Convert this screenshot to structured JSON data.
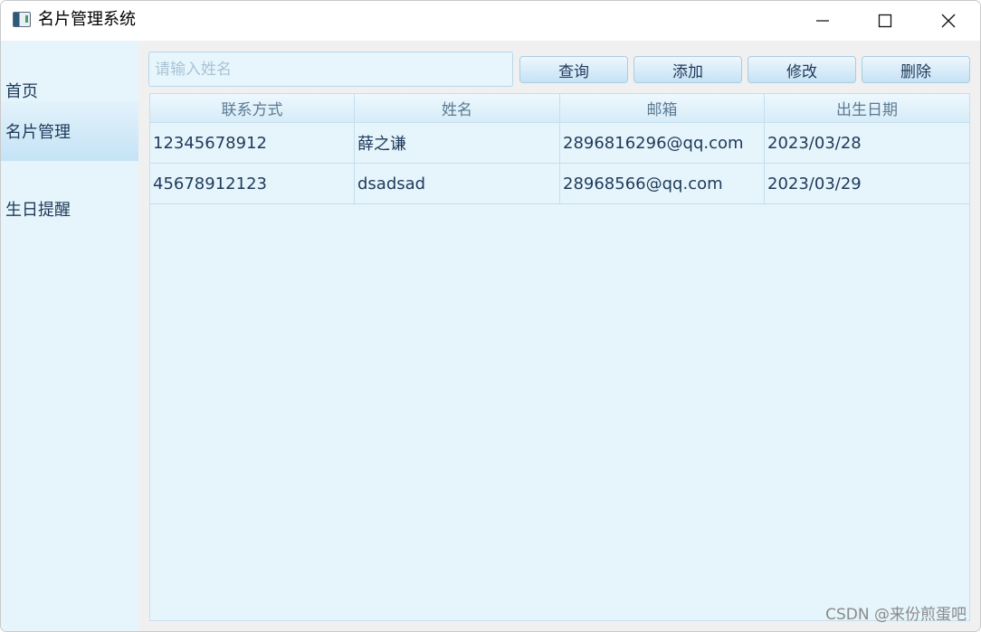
{
  "window": {
    "title": "名片管理系统"
  },
  "sidebar": {
    "items": [
      {
        "label": "首页",
        "active": false
      },
      {
        "label": "名片管理",
        "active": true
      },
      {
        "label": "生日提醒",
        "active": false
      }
    ]
  },
  "toolbar": {
    "search_placeholder": "请输入姓名",
    "search_value": "",
    "query_label": "查询",
    "add_label": "添加",
    "edit_label": "修改",
    "delete_label": "删除"
  },
  "table": {
    "columns": [
      "联系方式",
      "姓名",
      "邮箱",
      "出生日期"
    ],
    "rows": [
      [
        "12345678912",
        "薛之谦",
        "2896816296@qq.com",
        "2023/03/28"
      ],
      [
        "45678912123",
        "dsadsad",
        "28968566@qq.com",
        "2023/03/29"
      ]
    ]
  },
  "watermark": "CSDN @来份煎蛋吧"
}
